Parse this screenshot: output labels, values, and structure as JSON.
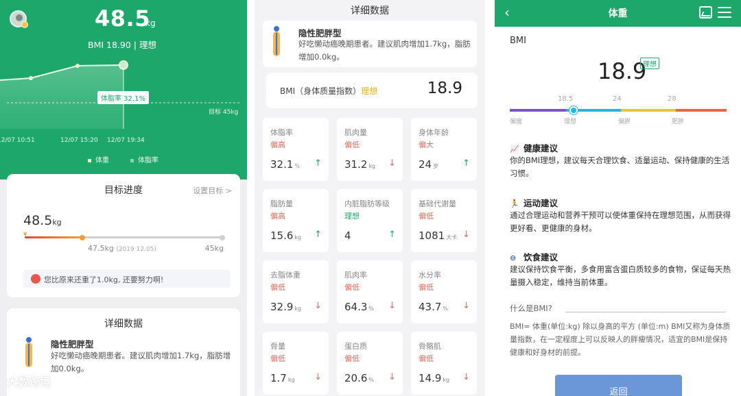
{
  "colors": {
    "brand_green": "#1ea76b",
    "ideal_yellow": "#e5b021",
    "low_red": "#e26b5c",
    "link_blue": "#2b63c4"
  },
  "home": {
    "weight_value": "48.5",
    "weight_unit": "kg",
    "bmi_line": "BMI 18.90 | 理想",
    "chart_data": {
      "type": "line",
      "x": [
        "12/07 10:51",
        "12/07 15:20",
        "12/07 19:34"
      ],
      "legend": [
        "体重",
        "体脂率"
      ],
      "tooltip": "体脂率 32.1%",
      "goal_label": "目标 45kg"
    },
    "progress": {
      "title": "目标进度",
      "set_goal": "设置目标 >",
      "current_value": "48.5",
      "current_unit": "kg",
      "start_value": "47.5kg",
      "start_date": "(2019 12.05)",
      "goal_value": "45kg",
      "progress_fraction": 0.29,
      "tip": "您比原来还重了1.0kg, 还要努力啊!"
    },
    "detail_title": "详细数据",
    "body_type_title": "隐性肥胖型",
    "body_type_desc": "好吃懒动癌晚期患者。建议肌肉增加1.7kg，脂肪增加0.0kg。"
  },
  "detail": {
    "title": "详细数据",
    "body_type_title": "隐性肥胖型",
    "body_type_desc": "好吃懒动癌晚期患者。建议肌肉增加1.7kg，脂肪增加0.0kg。",
    "bmi_label": "BMI（身体质量指数）",
    "bmi_tag": "理想",
    "bmi_value": "18.9",
    "metrics": [
      {
        "name": "体脂率",
        "status": "偏高",
        "value": "32.1",
        "unit": "%",
        "trend": "up"
      },
      {
        "name": "肌肉量",
        "status": "偏低",
        "value": "31.2",
        "unit": "kg",
        "trend": "down"
      },
      {
        "name": "身体年龄",
        "status": "偏大",
        "value": "24",
        "unit": "岁",
        "trend": "up"
      },
      {
        "name": "脂肪量",
        "status": "偏高",
        "value": "15.6",
        "unit": "kg",
        "trend": "up"
      },
      {
        "name": "内脏脂肪等级",
        "status": "理想",
        "value": "4",
        "unit": "",
        "trend": "up"
      },
      {
        "name": "基础代谢量",
        "status": "偏低",
        "value": "1081",
        "unit": "大卡",
        "trend": "down"
      },
      {
        "name": "去脂体重",
        "status": "偏低",
        "value": "32.9",
        "unit": "kg",
        "trend": "down"
      },
      {
        "name": "肌肉率",
        "status": "偏低",
        "value": "64.3",
        "unit": "%",
        "trend": "down"
      },
      {
        "name": "水分率",
        "status": "偏低",
        "value": "43.7",
        "unit": "%",
        "trend": "down"
      },
      {
        "name": "骨量",
        "status": "偏低",
        "value": "1.7",
        "unit": "kg",
        "trend": "down"
      },
      {
        "name": "蛋白质",
        "status": "偏低",
        "value": "20.6",
        "unit": "%",
        "trend": "down"
      },
      {
        "name": "骨骼肌",
        "status": "偏低",
        "value": "14.9",
        "unit": "kg",
        "trend": "down"
      }
    ]
  },
  "bmi_page": {
    "nav_title": "体重",
    "back_icon": "chevron-left-icon",
    "section": "BMI",
    "value": "18.9",
    "tag": "理想",
    "scale_numbers": [
      "18.5",
      "24",
      "28"
    ],
    "scale_labels": [
      "偏瘦",
      "理想",
      "偏胖",
      "肥胖"
    ],
    "scale_colors": [
      "#7b52c8",
      "#28b4e0",
      "#f2c13a",
      "#e8693a"
    ],
    "health_title": "健康建议",
    "health_text": "你的BMI理想，建议每天合理饮食、适量运动、保持健康的生活习惯。",
    "sport_title": "运动建议",
    "sport_text": "通过合理运动和营养干预可以使体重保持在理想范围，从而获得更好看、更健康的身材。",
    "diet_title": "饮食建议",
    "diet_text": "建议保持饮食平衡，多食用富含蛋白质较多的食物，保证每天热量摄入稳定，维持当前体重。",
    "question": "什么是BMI?",
    "definition": "BMI= 体重(单位:kg) 除以身高的平方 (单位:m) BMI又称为身体质量指数，在一定程度上可以反映人的胖瘦情况，适宜的BMI是保持健康和好身材的前提。",
    "back_button": "返回"
  },
  "watermark": "大数跨境"
}
